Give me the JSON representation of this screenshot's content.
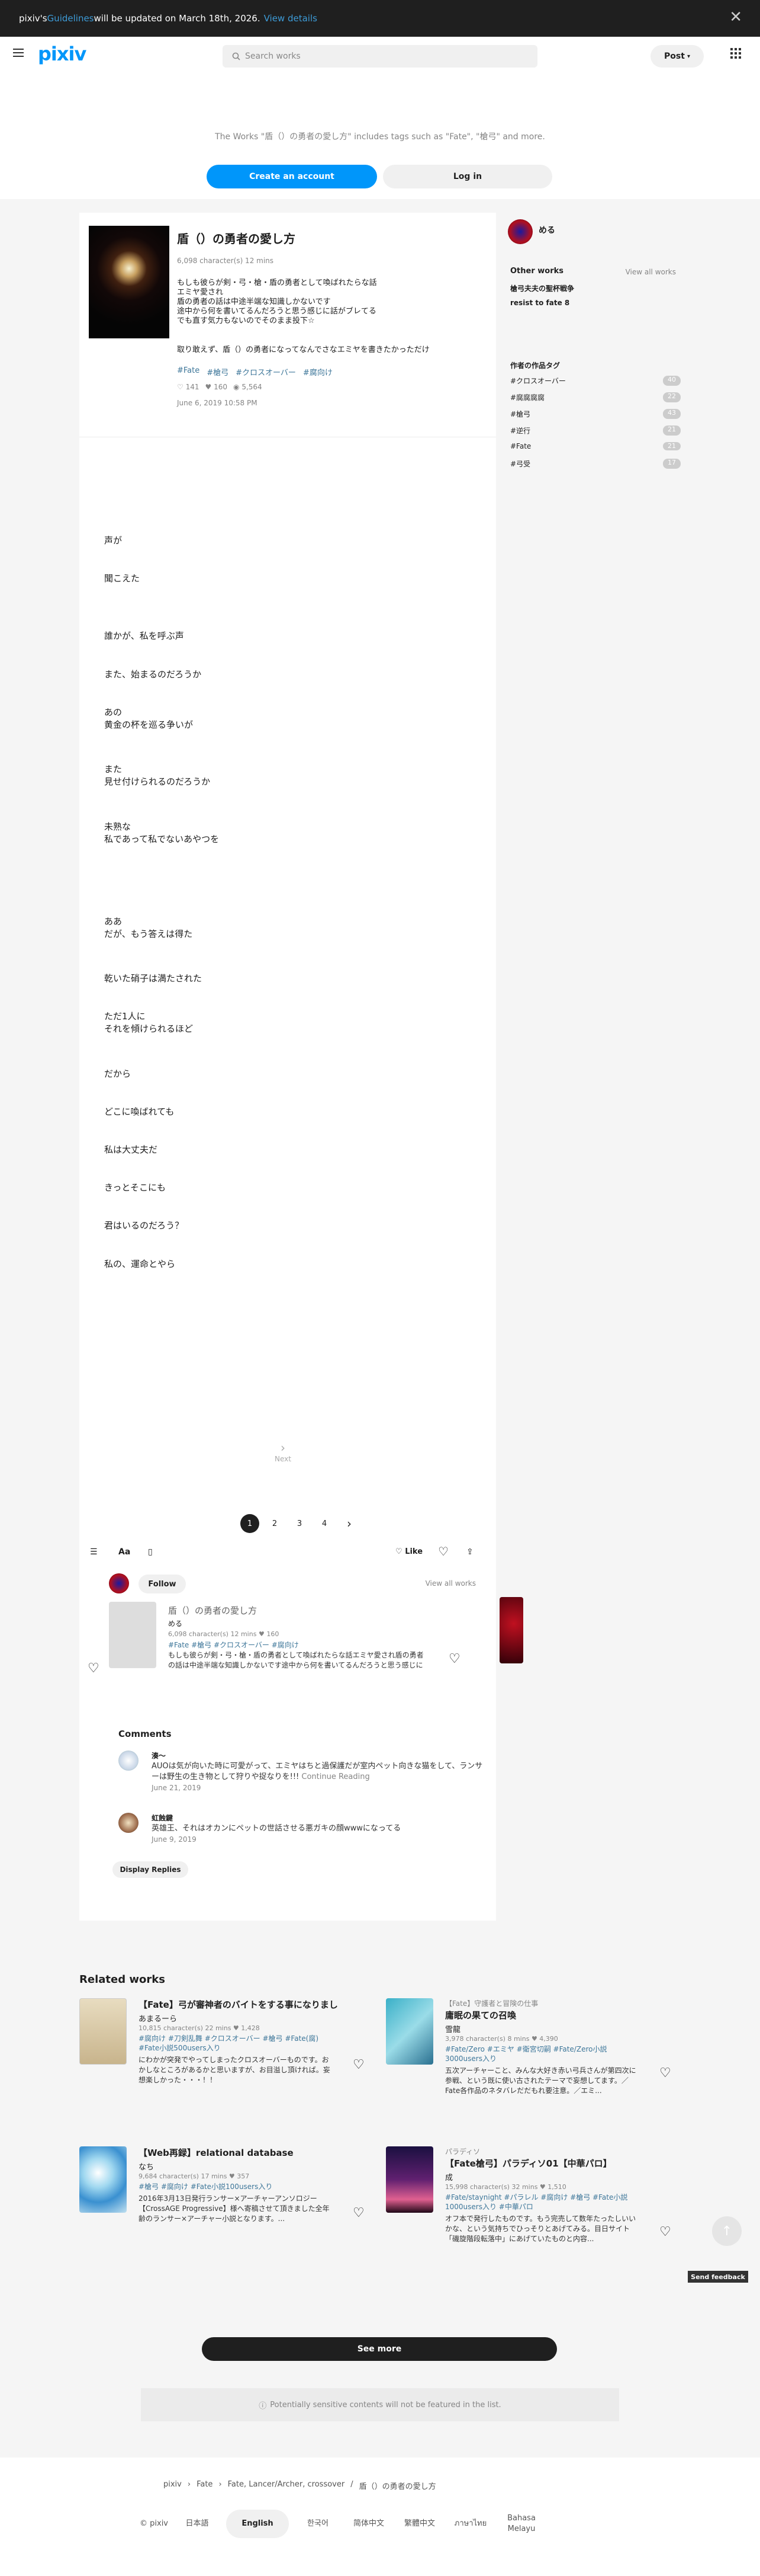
{
  "banner": {
    "pre": "pixiv's ",
    "link": "Guidelines",
    "post": " will be updated on March 18th, 2026.",
    "details": "View details"
  },
  "header": {
    "logo": "pixiv",
    "search_placeholder": "Search works",
    "post": "Post"
  },
  "cta": {
    "text": "The Works \"盾（）の勇者の愛し方\" includes tags such as \"Fate\", \"槍弓\" and more.",
    "create": "Create an account",
    "login": "Log in"
  },
  "work": {
    "title": "盾（）の勇者の愛し方",
    "meta": "6,098 character(s)  12 mins",
    "description": [
      "もしも彼らが剣・弓・槍・盾の勇者として喚ばれたらな話",
      "エミヤ愛され",
      "盾の勇者の話は中途半端な知識しかないです",
      "途中から何を書いてるんだろうと思う感じに話がブレてる",
      "でも直す気力もないのでそのまま投下☆"
    ],
    "note": "取り敢えず、盾（）の勇者になってなんでさなエミヤを書きたかっただけ",
    "tags": [
      "#Fate",
      "#槍弓",
      "#クロスオーバー",
      "#腐向け"
    ],
    "likes": "141",
    "bookmarks": "160",
    "views": "5,564",
    "date": "June 6, 2019 10:58 PM"
  },
  "body_lines": [
    "声が",
    "聞こえた",
    "誰かが、私を呼ぶ声",
    "また、始まるのだろうか",
    "あの\n黄金の杯を巡る争いが",
    "また\n見せ付けられるのだろうか",
    "未熟な\n私であって私でないあやつを",
    "ああ\nだが、もう答えは得た",
    "乾いた硝子は満たされた",
    "ただ1人に\nそれを傾けられるほど",
    "だから",
    "どこに喚ばれても",
    "私は大丈夫だ",
    "きっとそこにも",
    "君はいるのだろう？",
    "私の、運命とやら"
  ],
  "next": "Next",
  "pages": [
    "1",
    "2",
    "3",
    "4"
  ],
  "toolbar": {
    "like": "Like"
  },
  "author": {
    "name": "める",
    "follow": "Follow",
    "view_all": "View all works"
  },
  "mini": {
    "title": "盾（）の勇者の愛し方",
    "author": "める",
    "meta": "6,098 character(s)  12 mins",
    "likes": "160",
    "tags": "#Fate  #槍弓  #クロスオーバー  #腐向け",
    "text": "もしも彼らが剣・弓・槍・盾の勇者として喚ばれたらな話エミヤ愛され盾の勇者の話は中途半端な知識しかないです途中から何を書いてるんだろうと思う感じに話がブレてるでも直す気力もないのでそのまま投下☆取...",
    "continue": "Continue Reading"
  },
  "comments": {
    "title": "Comments",
    "items": [
      {
        "name": "湊〜",
        "text": "AUOは気が向いた時に可愛がって、エミヤはちと過保護だが室内ペット向きな猫をして、ランサーは野生の生き物として狩りや捉なりを!!!",
        "more": "Continue Reading",
        "date": "June 21, 2019"
      },
      {
        "name": "虹蝕鍵",
        "text": "英雄王、それはオカンにペットの世話させる悪ガキの顔wwwになってる",
        "date": "June 9, 2019"
      }
    ],
    "display_replies": "Display Replies"
  },
  "sidebar": {
    "name": "める",
    "other": "Other works",
    "view_all": "View all works",
    "works": [
      "槍弓夫夫の聖杯戦争",
      "resist to fate 8"
    ],
    "tags_title": "作者の作品タグ",
    "tags": [
      {
        "t": "#クロスオーバー",
        "c": "40"
      },
      {
        "t": "#腐腐腐腐",
        "c": "22"
      },
      {
        "t": "#槍弓",
        "c": "43"
      },
      {
        "t": "#逆行",
        "c": "21"
      },
      {
        "t": "#Fate",
        "c": "21"
      },
      {
        "t": "#弓受",
        "c": "17"
      }
    ]
  },
  "related": {
    "title": "Related works",
    "items": [
      {
        "cat": "",
        "title": "【Fate】弓が審神者のバイトをする事になりまし",
        "auth": "あまるーら",
        "meta": "10,815 character(s)  22 mins  ♥ 1,428",
        "tags": "#腐向け  #刀剣乱舞  #クロスオーバー  #槍弓  #Fate(腐)  #Fate小説500users入り",
        "desc": "にわかが突発でやってしまったクロスオーバーものです。おかしなところがあるかと思いますが、お目溢し頂ければ。妄想楽しかった・・・！！"
      },
      {
        "cat": "【Fate】守護者と冒険の仕事",
        "title": "庸眠の果ての召喚",
        "auth": "雪龍",
        "meta": "3,978 character(s)  8 mins  ♥ 4,390",
        "tags": "#Fate/Zero  #エミヤ  #衛宮切嗣  #Fate/Zero小説3000users入り",
        "desc": "五次アーチャーこと、みんな大好き赤い弓兵さんが第四次に参戦、という既に使い古されたテーマで妄想してます。／Fate各作品のネタバレだだもれ要注意。／エミ..."
      },
      {
        "cat": "",
        "title": "【Web再録】relational database",
        "auth": "なち",
        "meta": "9,684 character(s)  17 mins  ♥ 357",
        "tags": "#槍弓  #腐向け  #Fate小説100users入り",
        "desc": "2016年3月13日発行ランサー×アーチャーアンソロジー【CrossAGE Progressive】様へ寄稿させて頂きました全年齢のランサー×アーチャー小説となります。..."
      },
      {
        "cat": "パラディソ",
        "title": "【Fate槍弓】パラディソ01【中華パロ】",
        "auth": "成",
        "meta": "15,998 character(s)  32 mins  ♥ 1,510",
        "tags": "#Fate/staynight  #パラレル  #腐向け  #槍弓  #Fate小説1000users入り  #中華パロ",
        "desc": "オフ本で発行したものです。もう完売して数年たったしいいかな、という気持ちでひっそりとあげてみる。目日サイト「磯旋階段転落中」にあげていたものと内容..."
      }
    ],
    "see_more": "See more"
  },
  "note": "Potentially sensitive contents will not be featured in the list.",
  "feedback": "Send feedback",
  "footer": {
    "crumb": [
      "pixiv",
      "Fate",
      "Fate, Lancer/Archer, crossover",
      "盾（）の勇者の愛し方"
    ],
    "langs": [
      "© pixiv",
      "日本語",
      "English",
      "한국어",
      "简体中文",
      "繁體中文",
      "ภาษาไทย",
      "Bahasa Melayu"
    ]
  },
  "colors": {
    "accent": "#0096fa",
    "tag": "#3d7699",
    "dark": "#1f1f1f"
  }
}
